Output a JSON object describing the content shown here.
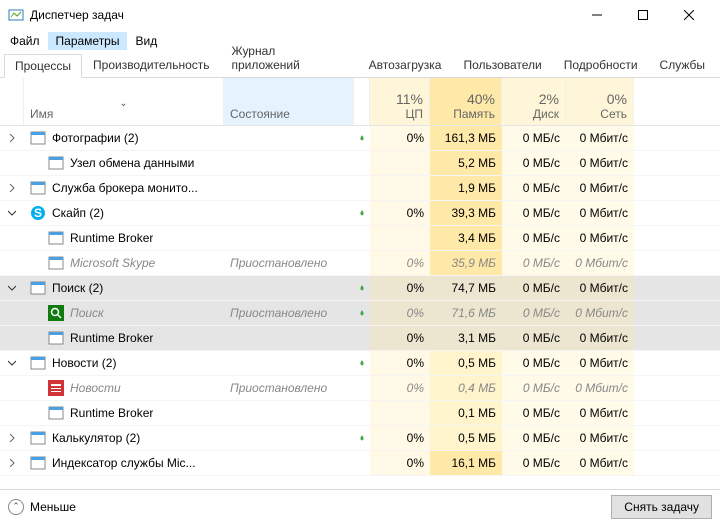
{
  "window": {
    "title": "Диспетчер задач"
  },
  "menu": {
    "file": "Файл",
    "options": "Параметры",
    "view": "Вид"
  },
  "tabs": {
    "processes": "Процессы",
    "performance": "Производительность",
    "app_history": "Журнал приложений",
    "startup": "Автозагрузка",
    "users": "Пользователи",
    "details": "Подробности",
    "services": "Службы"
  },
  "columns": {
    "name": "Имя",
    "state": "Состояние",
    "cpu_pct": "11%",
    "cpu": "ЦП",
    "mem_pct": "40%",
    "mem": "Память",
    "disk_pct": "2%",
    "disk": "Диск",
    "net_pct": "0%",
    "net": "Сеть"
  },
  "rows": [
    {
      "exp": ">",
      "icon": "photos",
      "name": "Фотографии (2)",
      "indent": 0,
      "leaf": true,
      "cpu": "0%",
      "mem": "161,3 МБ",
      "mem_hi": true,
      "disk": "0 МБ/с",
      "net": "0 Мбит/с"
    },
    {
      "exp": "",
      "icon": "generic",
      "name": "Узел обмена данными",
      "indent": 1,
      "cpu": "",
      "mem": "5,2 МБ",
      "disk": "0 МБ/с",
      "net": "0 Мбит/с"
    },
    {
      "exp": ">",
      "icon": "generic",
      "name": "Служба брокера монито...",
      "indent": 0,
      "cpu": "",
      "mem": "1,9 МБ",
      "disk": "0 МБ/с",
      "net": "0 Мбит/с"
    },
    {
      "exp": "v",
      "icon": "skype",
      "name": "Скайп (2)",
      "indent": 0,
      "leaf": true,
      "cpu": "0%",
      "mem": "39,3 МБ",
      "disk": "0 МБ/с",
      "net": "0 Мбит/с"
    },
    {
      "exp": "",
      "icon": "generic",
      "name": "Runtime Broker",
      "indent": 1,
      "cpu": "",
      "mem": "3,4 МБ",
      "disk": "0 МБ/с",
      "net": "0 Мбит/с"
    },
    {
      "exp": "",
      "icon": "generic",
      "name": "Microsoft Skype",
      "indent": 1,
      "state": "Приостановлено",
      "suspended": true,
      "cpu": "0%",
      "mem": "35,9 МБ",
      "disk": "0 МБ/с",
      "net": "0 Мбит/с"
    },
    {
      "exp": "v",
      "icon": "search",
      "name": "Поиск (2)",
      "indent": 0,
      "leaf": true,
      "selected": true,
      "cpu": "0%",
      "mem": "74,7 МБ",
      "disk": "0 МБ/с",
      "net": "0 Мбит/с"
    },
    {
      "exp": "",
      "icon": "search-green",
      "name": "Поиск",
      "indent": 1,
      "state": "Приостановлено",
      "leaf": true,
      "suspended": true,
      "selected": true,
      "cpu": "0%",
      "mem": "71,6 МБ",
      "disk": "0 МБ/с",
      "net": "0 Мбит/с"
    },
    {
      "exp": "",
      "icon": "generic",
      "name": "Runtime Broker",
      "indent": 1,
      "selected": true,
      "cpu": "0%",
      "mem": "3,1 МБ",
      "disk": "0 МБ/с",
      "net": "0 Мбит/с"
    },
    {
      "exp": "v",
      "icon": "generic",
      "name": "Новости (2)",
      "indent": 0,
      "leaf": true,
      "cpu": "0%",
      "mem": "0,5 МБ",
      "mem_low": true,
      "disk": "0 МБ/с",
      "net": "0 Мбит/с"
    },
    {
      "exp": "",
      "icon": "news",
      "name": "Новости",
      "indent": 1,
      "state": "Приостановлено",
      "suspended": true,
      "cpu": "0%",
      "mem": "0,4 МБ",
      "mem_low": true,
      "disk": "0 МБ/с",
      "net": "0 Мбит/с"
    },
    {
      "exp": "",
      "icon": "generic",
      "name": "Runtime Broker",
      "indent": 1,
      "cpu": "",
      "mem": "0,1 МБ",
      "mem_low": true,
      "disk": "0 МБ/с",
      "net": "0 Мбит/с"
    },
    {
      "exp": ">",
      "icon": "generic",
      "name": "Калькулятор (2)",
      "indent": 0,
      "leaf": true,
      "cpu": "0%",
      "mem": "0,5 МБ",
      "mem_low": true,
      "disk": "0 МБ/с",
      "net": "0 Мбит/с"
    },
    {
      "exp": ">",
      "icon": "generic",
      "name": "Индексатор службы Mic...",
      "indent": 0,
      "cpu": "0%",
      "mem": "16,1 МБ",
      "disk": "0 МБ/с",
      "net": "0 Мбит/с"
    }
  ],
  "footer": {
    "less": "Меньше",
    "end_task": "Снять задачу"
  }
}
